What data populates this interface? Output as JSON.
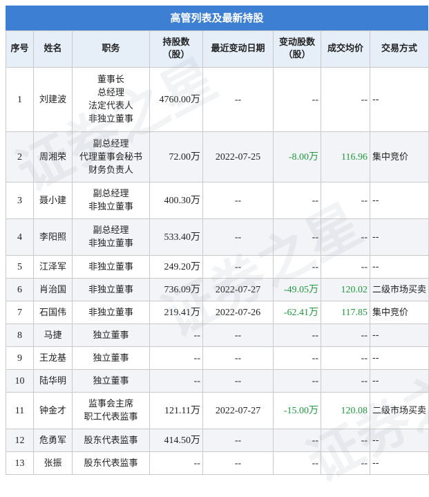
{
  "title": "高管列表及最新持股",
  "headers": {
    "seq": "序号",
    "name": "姓名",
    "position": "职务",
    "shares_line1": "持股数",
    "shares_line2": "（股）",
    "date": "最近变动日期",
    "change_line1": "变动股数",
    "change_line2": "（股）",
    "price": "成交均价",
    "method": "交易方式"
  },
  "rows": [
    {
      "seq": "1",
      "name": "刘建波",
      "position": "董事长\n总经理\n法定代表人\n非独立董事",
      "shares": "4760.00万",
      "date": "--",
      "change": "--",
      "price": "--",
      "method": "--"
    },
    {
      "seq": "2",
      "name": "周湘荣",
      "position": "副总经理\n代理董事会秘书\n财务负责人",
      "shares": "72.00万",
      "date": "2022-07-25",
      "change": "-8.00万",
      "price": "116.96",
      "method": "集中竞价"
    },
    {
      "seq": "3",
      "name": "聂小建",
      "position": "副总经理\n非独立董事",
      "shares": "400.30万",
      "date": "--",
      "change": "--",
      "price": "--",
      "method": "--"
    },
    {
      "seq": "4",
      "name": "李阳照",
      "position": "副总经理\n非独立董事",
      "shares": "533.40万",
      "date": "--",
      "change": "--",
      "price": "--",
      "method": "--"
    },
    {
      "seq": "5",
      "name": "江泽军",
      "position": "非独立董事",
      "shares": "249.20万",
      "date": "--",
      "change": "--",
      "price": "--",
      "method": "--"
    },
    {
      "seq": "6",
      "name": "肖治国",
      "position": "非独立董事",
      "shares": "736.09万",
      "date": "2022-07-27",
      "change": "-49.05万",
      "price": "120.02",
      "method": "二级市场买卖"
    },
    {
      "seq": "7",
      "name": "石国伟",
      "position": "非独立董事",
      "shares": "219.41万",
      "date": "2022-07-26",
      "change": "-62.41万",
      "price": "117.85",
      "method": "集中竞价"
    },
    {
      "seq": "8",
      "name": "马捷",
      "position": "独立董事",
      "shares": "--",
      "date": "--",
      "change": "--",
      "price": "--",
      "method": "--"
    },
    {
      "seq": "9",
      "name": "王龙基",
      "position": "独立董事",
      "shares": "--",
      "date": "--",
      "change": "--",
      "price": "--",
      "method": "--"
    },
    {
      "seq": "10",
      "name": "陆华明",
      "position": "独立董事",
      "shares": "--",
      "date": "--",
      "change": "--",
      "price": "--",
      "method": "--"
    },
    {
      "seq": "11",
      "name": "钟金才",
      "position": "监事会主席\n职工代表监事",
      "shares": "121.11万",
      "date": "2022-07-27",
      "change": "-15.00万",
      "price": "120.08",
      "method": "二级市场买卖"
    },
    {
      "seq": "12",
      "name": "危勇军",
      "position": "股东代表监事",
      "shares": "414.50万",
      "date": "--",
      "change": "--",
      "price": "--",
      "method": "--"
    },
    {
      "seq": "13",
      "name": "张振",
      "position": "股东代表监事",
      "shares": "--",
      "date": "--",
      "change": "--",
      "price": "--",
      "method": "--"
    }
  ],
  "colors": {
    "header_bar": "#3d7fd2",
    "header_row": "#e6eef8",
    "alt_row": "#f2f4f7",
    "change_text": "#1f9a3d"
  },
  "watermark_text": "证券之星"
}
